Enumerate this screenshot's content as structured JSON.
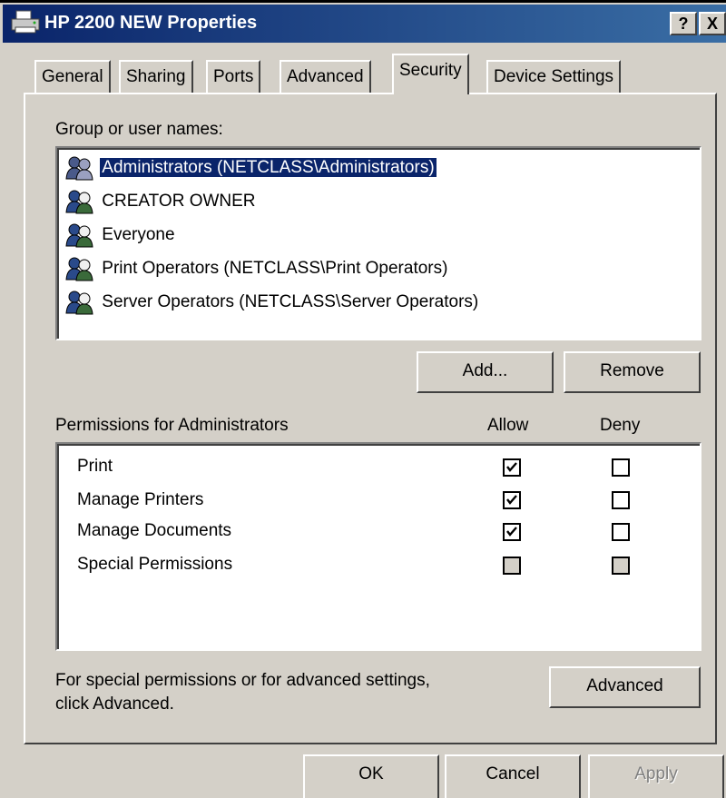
{
  "window": {
    "title": "HP 2200 NEW Properties",
    "help_button": "?",
    "close_button": "X"
  },
  "tabs": [
    "General",
    "Sharing",
    "Ports",
    "Advanced",
    "Security",
    "Device Settings"
  ],
  "active_tab": "Security",
  "groups": {
    "label": "Group or user names:",
    "users": [
      "Administrators (NETCLASS\\Administrators)",
      "CREATOR OWNER",
      "Everyone",
      "Print Operators (NETCLASS\\Print Operators)",
      "Server Operators (NETCLASS\\Server Operators)"
    ],
    "selected_index": 0,
    "add_button": "Add...",
    "remove_button": "Remove"
  },
  "permissions": {
    "label": "Permissions for Administrators",
    "allow_header": "Allow",
    "deny_header": "Deny",
    "rows": [
      {
        "name": "Print",
        "allow": "checked",
        "deny": "unchecked"
      },
      {
        "name": "Manage Printers",
        "allow": "checked",
        "deny": "unchecked"
      },
      {
        "name": "Manage Documents",
        "allow": "checked",
        "deny": "unchecked"
      },
      {
        "name": "Special Permissions",
        "allow": "disabled",
        "deny": "disabled"
      }
    ]
  },
  "advanced_note": {
    "line1": "For special permissions or for advanced settings,",
    "line2": "click Advanced.",
    "button": "Advanced"
  },
  "footer": {
    "ok": "OK",
    "cancel": "Cancel",
    "apply": "Apply"
  },
  "colors": {
    "titlebar": "#0a246a",
    "selection": "#0a246a",
    "face": "#d4d0c8"
  }
}
